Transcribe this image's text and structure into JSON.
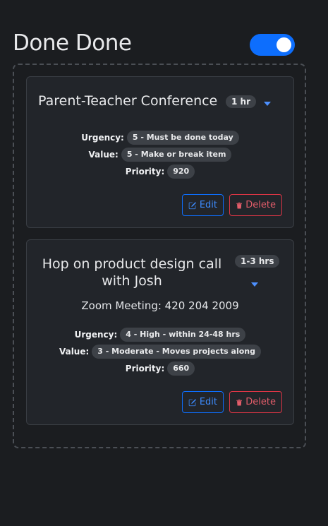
{
  "header": {
    "title": "Done Done",
    "toggle_on": true
  },
  "colors": {
    "accent": "#0d6efd",
    "danger": "#dc3545",
    "background": "#1b1d20",
    "card": "#22252a"
  },
  "cards": [
    {
      "title": "Parent-Teacher Conference",
      "duration": "1 hr",
      "description": "",
      "urgency_label": "Urgency:",
      "urgency": "5 - Must be done today",
      "value_label": "Value:",
      "value": "5 - Make or break item",
      "priority_label": "Priority:",
      "priority": "920",
      "edit_label": "Edit",
      "delete_label": "Delete",
      "icons": [
        "chevron-down-icon",
        "edit-icon",
        "trash-icon"
      ]
    },
    {
      "title": "Hop on product design call with Josh",
      "duration": "1-3 hrs",
      "description": "Zoom Meeting: 420 204 2009",
      "urgency_label": "Urgency:",
      "urgency": "4 - High - within 24-48 hrs",
      "value_label": "Value:",
      "value": "3 - Moderate - Moves projects along",
      "priority_label": "Priority:",
      "priority": "660",
      "edit_label": "Edit",
      "delete_label": "Delete",
      "icons": [
        "chevron-down-icon",
        "edit-icon",
        "trash-icon"
      ]
    }
  ]
}
